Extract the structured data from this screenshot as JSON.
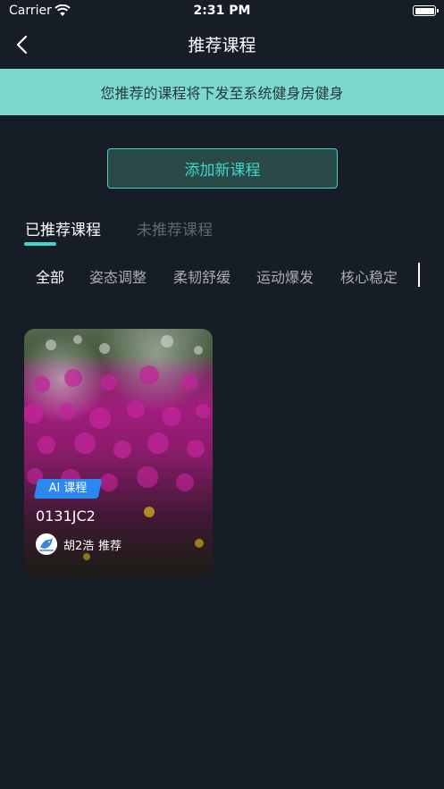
{
  "status_bar": {
    "carrier": "Carrier",
    "time": "2:31 PM"
  },
  "nav": {
    "title": "推荐课程"
  },
  "banner": {
    "text": "您推荐的课程将下发至系统健身房健身"
  },
  "add_button": {
    "label": "添加新课程"
  },
  "tabs": [
    {
      "label": "已推荐课程",
      "active": true
    },
    {
      "label": "未推荐课程",
      "active": false
    }
  ],
  "filters": [
    {
      "label": "全部",
      "selected": true
    },
    {
      "label": "姿态调整",
      "selected": false
    },
    {
      "label": "柔韧舒缓",
      "selected": false
    },
    {
      "label": "运动爆发",
      "selected": false
    },
    {
      "label": "核心稳定",
      "selected": false
    }
  ],
  "courses": [
    {
      "badge": "AI 课程",
      "name": "0131JC2",
      "recommender": "胡2浩",
      "recommend_suffix": "推荐",
      "image": "flower-field-photo"
    }
  ],
  "colors": {
    "accent": "#3fd6c4",
    "banner_bg": "#7fd8cf",
    "background": "#161d27",
    "badge": "#2a88f0"
  }
}
